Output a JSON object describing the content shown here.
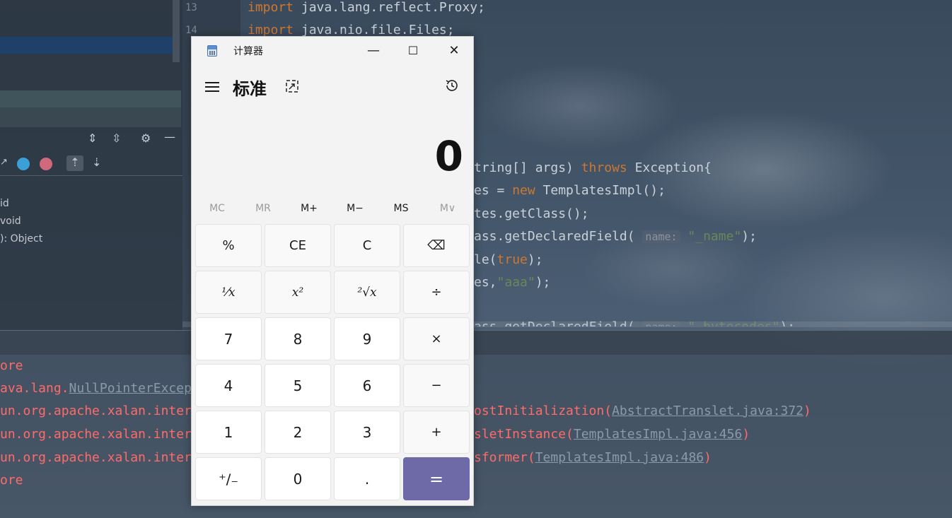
{
  "colors": {
    "accent_equals": "#6e6aa8",
    "keyword": "#cc7832",
    "string": "#6a8759",
    "console_error": "#ff6b68"
  },
  "ide": {
    "left_panel": {
      "toolbar_icons": [
        "expand-all-icon",
        "collapse-all-icon",
        "gear-icon",
        "minimize-icon"
      ],
      "structure_icons": [
        "field-icon",
        "lambda-icon",
        "sort-up-icon",
        "sort-down-icon"
      ],
      "items": [
        "id",
        "void",
        "): Object"
      ]
    },
    "gutter": {
      "line_13": "13",
      "line_14": "14"
    },
    "code": {
      "l1_kw": "import",
      "l1_rest": " java.lang.reflect.Proxy;",
      "l2_kw": "import",
      "l2_rest": " java.nio.file.Files;",
      "l3_a": "tring[] args) ",
      "l3_kw": "throws",
      "l3_b": " Exception{",
      "l4_a": "es = ",
      "l4_kw": "new",
      "l4_b": " TemplatesImpl();",
      "l5": "tes.getClass();",
      "l6_a": "ass.getDeclaredField(",
      "l6_hint": "name:",
      "l6_str": "\"_name\"",
      "l6_b": ");",
      "l7_a": "le(",
      "l7_kw": "true",
      "l7_b": ");",
      "l8_a": "es,",
      "l8_str": "\"aaa\"",
      "l8_b": ");",
      "l9_a": "ass.getDeclaredField(",
      "l9_hint": "name:",
      "l9_str": "\"_bytecodes\"",
      "l9_b": ");"
    },
    "console": {
      "c1": "ore",
      "c2_a": "ava.lang.",
      "c2_link": "NullPointerExcep",
      "c3_a": "un.org.apache.xalan.inter",
      "c3_b": "ostInitialization(",
      "c3_link": "AbstractTranslet.java:372",
      "c3_c": ")",
      "c4_a": "un.org.apache.xalan.inter",
      "c4_b": "sletInstance(",
      "c4_link": "TemplatesImpl.java:456",
      "c4_c": ")",
      "c5_a": "un.org.apache.xalan.inter",
      "c5_b": "sformer(",
      "c5_link": "TemplatesImpl.java:486",
      "c5_c": ")",
      "c6": "ore"
    }
  },
  "calculator": {
    "window_title": "计算器",
    "minimize": "—",
    "maximize": "☐",
    "close": "✕",
    "mode": "标准",
    "keep_on_top_icon": "keep-on-top-icon",
    "history_icon": "history-icon",
    "display_value": "0",
    "memory": [
      "MC",
      "MR",
      "M+",
      "M−",
      "MS",
      "M∨"
    ],
    "keys": {
      "percent": "%",
      "ce": "CE",
      "c": "C",
      "backspace": "⌫",
      "reciprocal": "¹⁄x",
      "square": "x²",
      "sqrt": "²√x",
      "divide": "÷",
      "seven": "7",
      "eight": "8",
      "nine": "9",
      "multiply": "×",
      "four": "4",
      "five": "5",
      "six": "6",
      "minus": "−",
      "one": "1",
      "two": "2",
      "three": "3",
      "plus": "+",
      "negate": "⁺∕₋",
      "zero": "0",
      "decimal": ".",
      "equals": "="
    }
  }
}
